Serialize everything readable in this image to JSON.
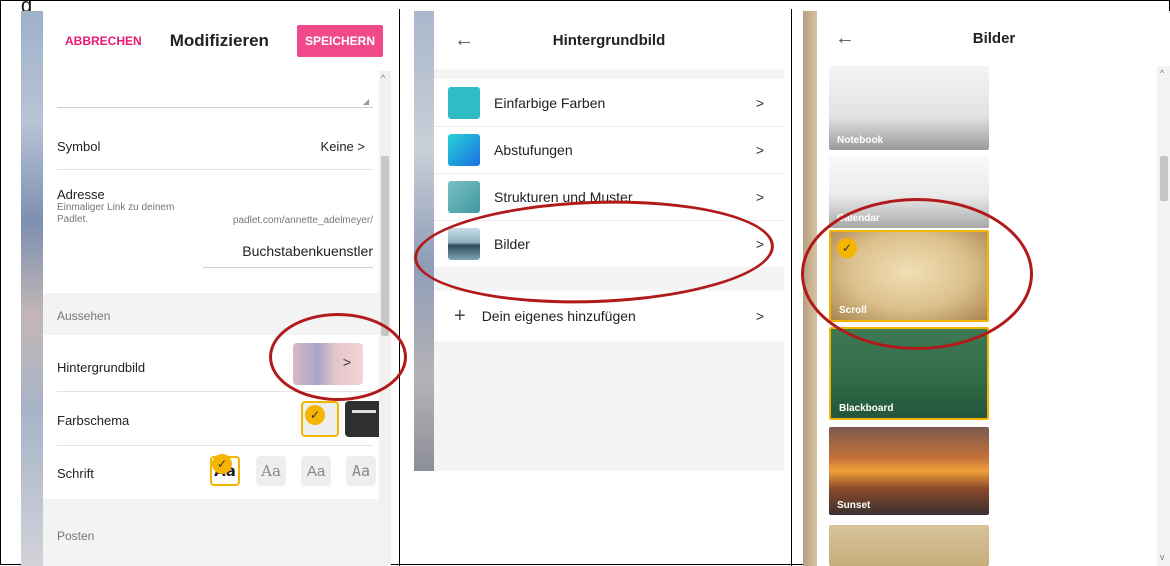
{
  "partial_label": "g",
  "panel1": {
    "cancel": "ABBRECHEN",
    "title": "Modifizieren",
    "save": "SPEICHERN",
    "symbol_label": "Symbol",
    "symbol_value": "Keine",
    "address_label": "Adresse",
    "address_hint": "Einmaliger Link zu deinem Padlet.",
    "address_prefix": "padlet.com/annette_adelmeyer/",
    "address_slug": "Buchstabenkuenstler",
    "section_appearance": "Aussehen",
    "background_label": "Hintergrundbild",
    "color_scheme_label": "Farbschema",
    "font_label": "Schrift",
    "font_samples": [
      "Aa",
      "Aa",
      "Aa",
      "Aa"
    ],
    "section_posts": "Posten"
  },
  "panel2": {
    "title": "Hintergrundbild",
    "items": [
      {
        "label": "Einfarbige Farben",
        "color": "#2fbcc7"
      },
      {
        "label": "Abstufungen",
        "color": "#1da6d6"
      },
      {
        "label": "Strukturen und Muster",
        "color": "#5aaeb4"
      },
      {
        "label": "Bilder",
        "color": "#7a9cad"
      }
    ],
    "add": "Dein eigenes hinzufügen"
  },
  "panel3": {
    "title": "Bilder",
    "tiles": [
      "Notebook",
      "Calendar",
      "Scroll",
      "Blackboard",
      "Sunset"
    ]
  },
  "colors": {
    "accent_pink": "#e8196f",
    "save_bg": "#f04a8a",
    "check_yellow": "#f5b400",
    "annotation_red": "#b11a1a"
  }
}
